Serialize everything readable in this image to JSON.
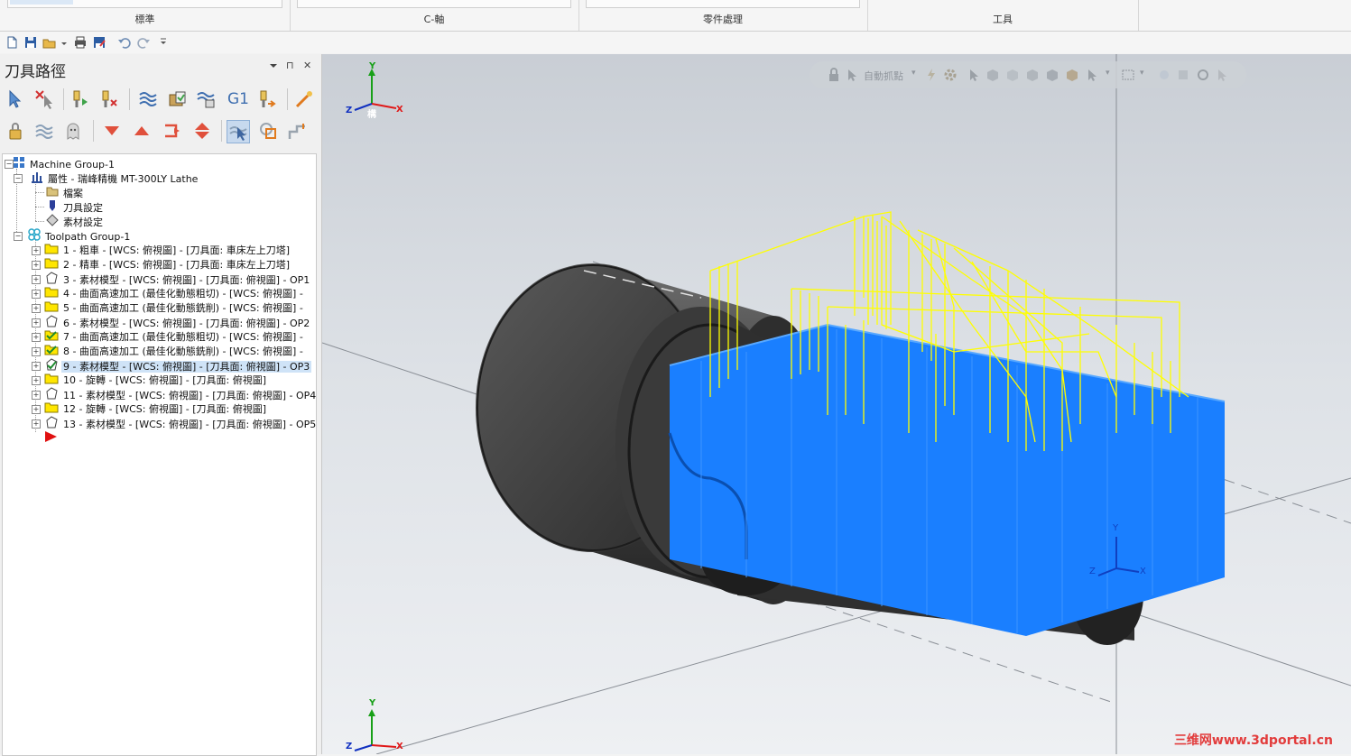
{
  "ribbon": {
    "groups": [
      {
        "label": "標準"
      },
      {
        "label": "C-軸"
      },
      {
        "label": "零件處理"
      },
      {
        "label": "工具"
      }
    ]
  },
  "panel": {
    "title": "刀具路徑",
    "pin": "⊓",
    "close": "✕",
    "toolbar_row1_text": "G1"
  },
  "tree": {
    "items": [
      {
        "label": "Machine Group-1"
      },
      {
        "label": "屬性 - 瑞峰精機 MT-300LY Lathe"
      },
      {
        "label": "檔案"
      },
      {
        "label": "刀具設定"
      },
      {
        "label": "素材設定"
      },
      {
        "label": "Toolpath Group-1"
      },
      {
        "label": "1 - 粗車 - [WCS: 俯視圖] - [刀具面: 車床左上刀塔]"
      },
      {
        "label": "2 - 精車 - [WCS: 俯視圖] - [刀具面: 車床左上刀塔]"
      },
      {
        "label": "3 - 素材模型 - [WCS: 俯視圖] - [刀具面: 俯視圖] - OP1"
      },
      {
        "label": "4 - 曲面高速加工 (最佳化動態粗切) - [WCS: 俯視圖] -"
      },
      {
        "label": "5 - 曲面高速加工 (最佳化動態銑削) - [WCS: 俯視圖] -"
      },
      {
        "label": "6 - 素材模型 - [WCS: 俯視圖] - [刀具面: 俯視圖] - OP2"
      },
      {
        "label": "7 - 曲面高速加工 (最佳化動態粗切) - [WCS: 俯視圖] -"
      },
      {
        "label": "8 - 曲面高速加工 (最佳化動態銑削) - [WCS: 俯視圖] -"
      },
      {
        "label": "9 - 素材模型 - [WCS: 俯視圖] - [刀具面: 俯視圖] - OP3"
      },
      {
        "label": "10 - 旋轉 - [WCS: 俯視圖] - [刀具面: 俯視圖]"
      },
      {
        "label": "11 - 素材模型 - [WCS: 俯視圖] - [刀具面: 俯視圖] - OP4"
      },
      {
        "label": "12 - 旋轉 - [WCS: 俯視圖] - [刀具面: 俯視圖]"
      },
      {
        "label": "13 - 素材模型 - [WCS: 俯視圖] - [刀具面: 俯視圖] - OP5"
      }
    ]
  },
  "viewport": {
    "toolbar_label": "自動抓點",
    "gnomon_top": {
      "x": "X",
      "y": "Y",
      "z": "Z",
      "tag": "構"
    },
    "gnomon_bottom": {
      "x": "X",
      "y": "Y",
      "z": "Z"
    },
    "gnomon_part": {
      "x": "X",
      "y": "Y",
      "z": "Z"
    },
    "watermark": "三维网www.3dportal.cn",
    "colors": {
      "toolpath_cut": "#1a7fff",
      "toolpath_rapid": "#ffff00",
      "stock": "#3c3c3c"
    }
  }
}
